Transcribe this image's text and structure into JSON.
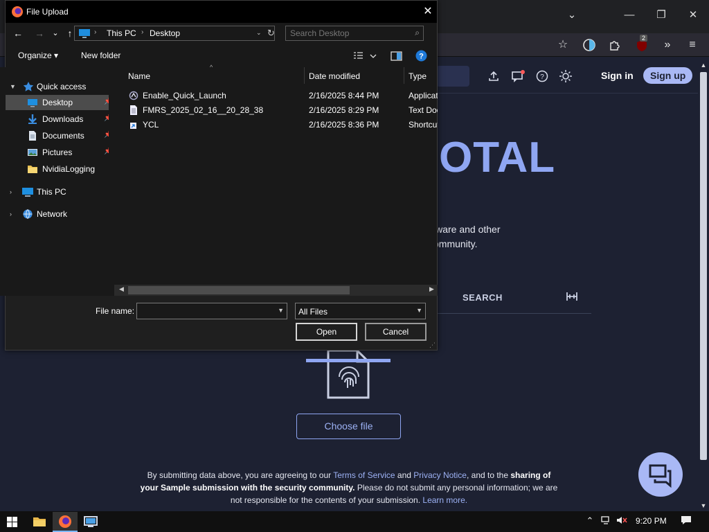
{
  "browser": {
    "window_controls": {
      "tab_list": "⌄",
      "minimize": "—",
      "maximize": "❐",
      "close": "✕"
    },
    "toolbar_icons": {
      "bookmark": "☆",
      "extension_badge_count": "2",
      "overflow": "»",
      "menu": "≡"
    }
  },
  "page": {
    "header": {
      "sign_in": "Sign in",
      "sign_up": "Sign up"
    },
    "hero_title_fragment": "OTAL",
    "hero_desc_fragment": "lware and other ommunity.",
    "tabs": {
      "search": "SEARCH"
    },
    "choose_file": "Choose file",
    "disclaimer": {
      "p1": "By submitting data above, you are agreeing to our ",
      "tos": "Terms of Service",
      "and": " and ",
      "privacy": "Privacy Notice",
      "p2": ", and to the ",
      "bold": "sharing of your Sample submission with the security community.",
      "p3": " Please do not submit any personal information; we are not responsible for the contents of your submission. ",
      "learn_more": "Learn more."
    }
  },
  "dialog": {
    "title": "File Upload",
    "close": "✕",
    "nav": {
      "back": "←",
      "forward": "→",
      "recent": "⌄",
      "up": "↑"
    },
    "breadcrumb": [
      "This PC",
      "Desktop"
    ],
    "search_placeholder": "Search Desktop",
    "commands": {
      "organize": "Organize ▾",
      "new_folder": "New folder"
    },
    "nav_pane": {
      "quick_access": "Quick access",
      "quick_items": [
        {
          "label": "Desktop",
          "selected": true
        },
        {
          "label": "Downloads"
        },
        {
          "label": "Documents"
        },
        {
          "label": "Pictures"
        },
        {
          "label": "NvidiaLogging"
        }
      ],
      "this_pc": "This PC",
      "network": "Network"
    },
    "columns": {
      "name": "Name",
      "date": "Date modified",
      "type": "Type"
    },
    "files": [
      {
        "name": "Enable_Quick_Launch",
        "date": "2/16/2025 8:44 PM",
        "type": "Application"
      },
      {
        "name": "FMRS_2025_02_16__20_28_38",
        "date": "2/16/2025 8:29 PM",
        "type": "Text Document"
      },
      {
        "name": "YCL",
        "date": "2/16/2025 8:36 PM",
        "type": "Shortcut"
      }
    ],
    "file_name_label": "File name:",
    "file_name_value": "",
    "filter": "All Files",
    "open": "Open",
    "cancel": "Cancel"
  },
  "taskbar": {
    "clock": "9:20 PM"
  },
  "colors": {
    "accent": "#8fa6f2",
    "page_bg": "#1d2132",
    "dialog_bg": "#191919",
    "selected": "#4c4c4c"
  }
}
